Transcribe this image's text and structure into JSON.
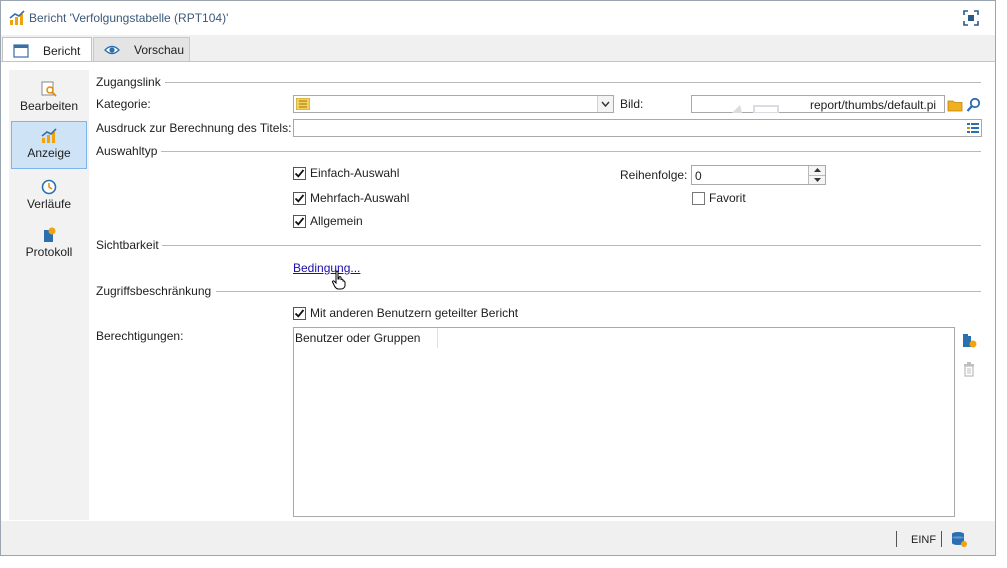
{
  "window": {
    "title": "Bericht 'Verfolgungstabelle (RPT104)'"
  },
  "tabs": [
    {
      "label": "Bericht",
      "icon": "window-icon",
      "active": true
    },
    {
      "label": "Vorschau",
      "icon": "eye-icon",
      "active": false
    }
  ],
  "sidenav": {
    "items": [
      {
        "label": "Bearbeiten",
        "icon": "edit-search-icon"
      },
      {
        "label": "Anzeige",
        "icon": "chart-icon",
        "active": true
      },
      {
        "label": "Verläufe",
        "icon": "clock-icon"
      },
      {
        "label": "Protokoll",
        "icon": "log-icon"
      }
    ]
  },
  "sections": {
    "zugangslink": "Zugangslink",
    "auswahltyp": "Auswahltyp",
    "sichtbarkeit": "Sichtbarkeit",
    "zugriff": "Zugriffsbeschränkung"
  },
  "fields": {
    "kategorie_label": "Kategorie:",
    "kategorie_value": "",
    "bild_label": "Bild:",
    "bild_value": "report/thumbs/default.pi",
    "ausdruck_label": "Ausdruck zur Berechnung des Titels:",
    "ausdruck_value": "",
    "reihenfolge_label": "Reihenfolge:",
    "reihenfolge_value": "0",
    "berechtigungen_label": "Berechtigungen:"
  },
  "checks": {
    "einfach": {
      "label": "Einfach-Auswahl",
      "checked": true
    },
    "mehrfach": {
      "label": "Mehrfach-Auswahl",
      "checked": true
    },
    "allgemein": {
      "label": "Allgemein",
      "checked": true
    },
    "favorit": {
      "label": "Favorit",
      "checked": false
    },
    "geteilt": {
      "label": "Mit anderen Benutzern geteilter Bericht",
      "checked": true
    }
  },
  "links": {
    "bedingung": "Bedingung..."
  },
  "permissions": {
    "column_header": "Benutzer oder Gruppen"
  },
  "status": {
    "mode": "EINF"
  },
  "colors": {
    "accent": "#f0a30a",
    "link": "#1a0dab",
    "selection": "#cfe3f7"
  }
}
